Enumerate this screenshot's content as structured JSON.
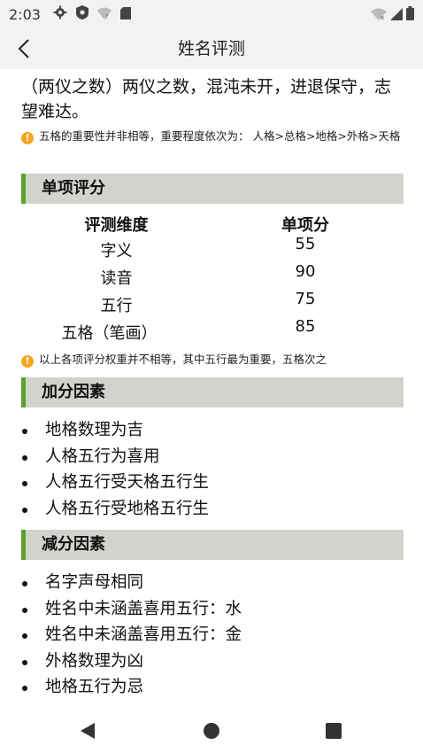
{
  "status_bar": {
    "time": "2:03",
    "icons": [
      "gear-icon",
      "shield-icon",
      "wifi-question-icon",
      "sd-card-icon",
      "wifi-x-icon",
      "signal-icon",
      "battery-icon"
    ]
  },
  "app_bar": {
    "title": "姓名评测",
    "back_icon": "chevron-left-icon"
  },
  "intro": {
    "text": "（两仪之数）两仪之数，混沌未开，进退保守，志望难达。"
  },
  "notes": {
    "importance": "五格的重要性并非相等，重要程度依次为： 人格>总格>地格>外格>天格",
    "weights": "以上各项评分权重并不相等，其中五行最为重要，五格次之"
  },
  "sections": {
    "single_score": {
      "title": "单项评分",
      "headers": {
        "dimension": "评测维度",
        "score": "单项分"
      },
      "rows": [
        {
          "dimension": "字义",
          "score": "55"
        },
        {
          "dimension": "读音",
          "score": "90"
        },
        {
          "dimension": "五行",
          "score": "75"
        },
        {
          "dimension": "五格（笔画）",
          "score": "85"
        }
      ]
    },
    "bonus": {
      "title": "加分因素",
      "items": [
        "地格数理为吉",
        "人格五行为喜用",
        "人格五行受天格五行生",
        "人格五行受地格五行生"
      ]
    },
    "deduction": {
      "title": "减分因素",
      "items": [
        "名字声母相同",
        "姓名中未涵盖喜用五行：水",
        "姓名中未涵盖喜用五行：金",
        "外格数理为凶",
        "地格五行为忌"
      ]
    }
  },
  "nav_bar": {
    "back": "back-triangle-icon",
    "home": "home-circle-icon",
    "recents": "recents-square-icon"
  },
  "colors": {
    "accent_green": "#5ba12a",
    "section_bg": "#d0d4cc",
    "note_orange": "#f5a623"
  }
}
